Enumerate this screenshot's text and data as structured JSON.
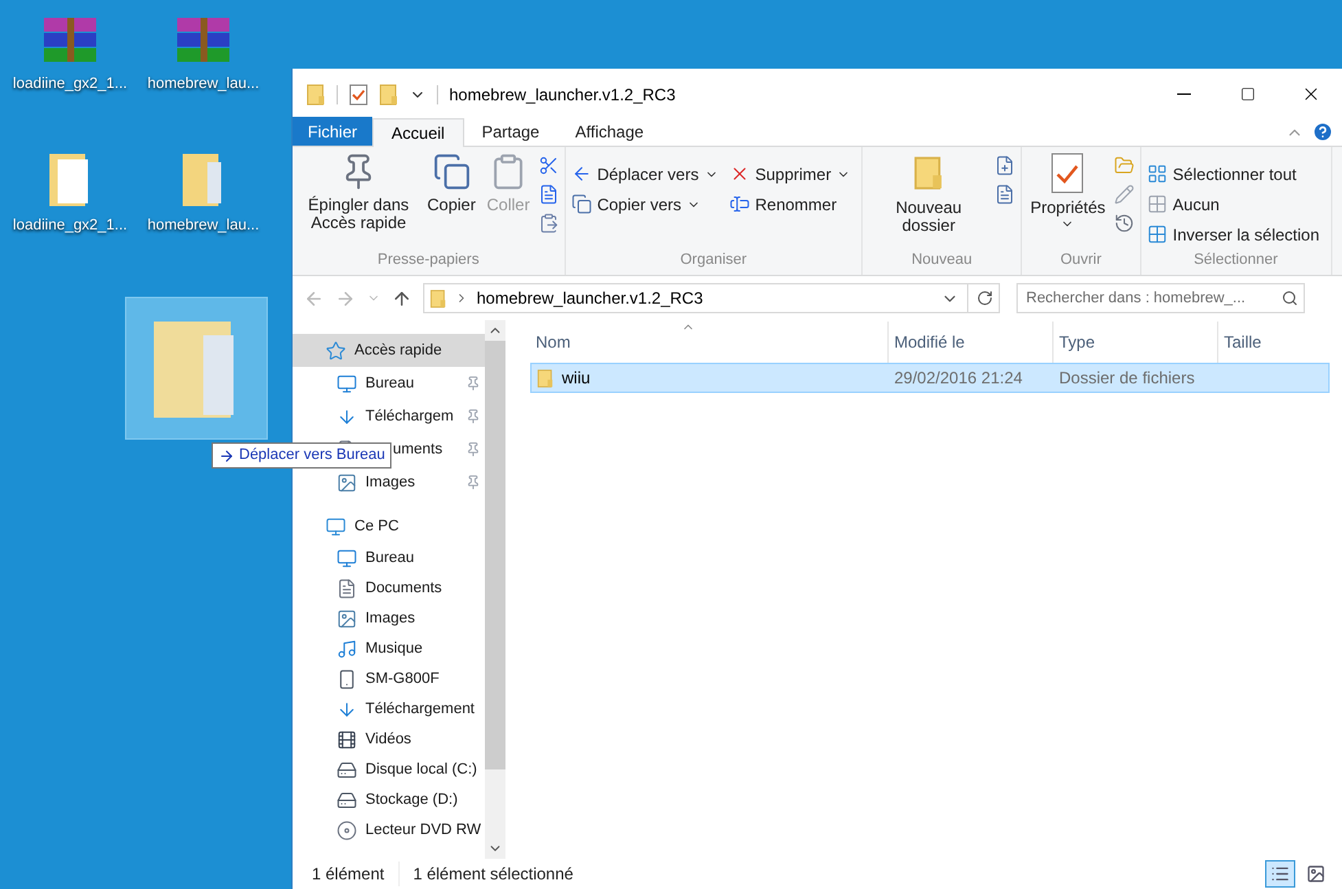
{
  "desktop": {
    "icons": [
      {
        "label": "loadiine_gx2_1...",
        "kind": "archive"
      },
      {
        "label": "homebrew_lau...",
        "kind": "archive"
      },
      {
        "label": "loadiine_gx2_1...",
        "kind": "document"
      },
      {
        "label": "homebrew_lau...",
        "kind": "folder"
      }
    ],
    "drag": {
      "tooltip": "Déplacer vers Bureau"
    }
  },
  "window": {
    "title": "homebrew_launcher.v1.2_RC3",
    "tabs": [
      {
        "label": "Fichier",
        "kind": "file",
        "selected": false
      },
      {
        "label": "Accueil",
        "kind": "tab",
        "selected": true
      },
      {
        "label": "Partage",
        "kind": "tab",
        "selected": false
      },
      {
        "label": "Affichage",
        "kind": "tab",
        "selected": false
      }
    ],
    "ribbon": [
      {
        "label": "Presse-papiers",
        "items": [
          {
            "kind": "large",
            "label": "Épingler dans Accès rapide",
            "disabled": false,
            "dropdown": false
          },
          {
            "kind": "large",
            "label": "Copier",
            "disabled": false,
            "dropdown": false
          },
          {
            "kind": "large",
            "label": "Coller",
            "disabled": true,
            "dropdown": false
          },
          {
            "kind": "icons"
          }
        ]
      },
      {
        "label": "Organiser",
        "items": [
          {
            "kind": "stack",
            "entries": [
              {
                "label": "Déplacer vers",
                "dropdown": true
              },
              {
                "label": "Copier vers",
                "dropdown": true
              }
            ]
          },
          {
            "kind": "stack",
            "entries": [
              {
                "label": "Supprimer",
                "dropdown": true
              },
              {
                "label": "Renommer",
                "dropdown": false
              }
            ]
          }
        ]
      },
      {
        "label": "Nouveau",
        "items": [
          {
            "kind": "large",
            "label": "Nouveau dossier",
            "disabled": false,
            "dropdown": false
          },
          {
            "kind": "icons"
          }
        ]
      },
      {
        "label": "Ouvrir",
        "items": [
          {
            "kind": "large",
            "label": "Propriétés",
            "disabled": false,
            "dropdown": true
          },
          {
            "kind": "icons"
          }
        ]
      },
      {
        "label": "Sélectionner",
        "items": [
          {
            "kind": "stack",
            "entries": [
              {
                "label": "Sélectionner tout",
                "dropdown": false
              },
              {
                "label": "Aucun",
                "dropdown": false
              },
              {
                "label": "Inverser la sélection",
                "dropdown": false
              }
            ]
          }
        ]
      }
    ],
    "address": {
      "path": "homebrew_launcher.v1.2_RC3",
      "search_placeholder": "Rechercher dans : homebrew_..."
    },
    "sidebar": [
      {
        "label": "Accès rapide",
        "kind": "star",
        "selected": true,
        "children": [
          {
            "label": "Bureau",
            "kind": "desktop",
            "pinned": true,
            "partly_hidden": false
          },
          {
            "label": "Téléchargem",
            "kind": "download",
            "pinned": true,
            "partly_hidden": false
          },
          {
            "label": "uments",
            "kind": "document",
            "pinned": true,
            "partly_hidden": true
          },
          {
            "label": "Images",
            "kind": "pictures",
            "pinned": true,
            "partly_hidden": false
          }
        ]
      },
      {
        "label": "Ce PC",
        "kind": "pc",
        "selected": false,
        "children": [
          {
            "label": "Bureau",
            "kind": "desktop",
            "pinned": false,
            "partly_hidden": false
          },
          {
            "label": "Documents",
            "kind": "document",
            "pinned": false,
            "partly_hidden": false
          },
          {
            "label": "Images",
            "kind": "pictures",
            "pinned": false,
            "partly_hidden": false
          },
          {
            "label": "Musique",
            "kind": "music",
            "pinned": false,
            "partly_hidden": false
          },
          {
            "label": "SM-G800F",
            "kind": "phone",
            "pinned": false,
            "partly_hidden": false
          },
          {
            "label": "Téléchargement",
            "kind": "download",
            "pinned": false,
            "partly_hidden": false
          },
          {
            "label": "Vidéos",
            "kind": "video",
            "pinned": false,
            "partly_hidden": false
          },
          {
            "label": "Disque local (C:)",
            "kind": "drive",
            "pinned": false,
            "partly_hidden": false
          },
          {
            "label": "Stockage (D:)",
            "kind": "drive",
            "pinned": false,
            "partly_hidden": false
          },
          {
            "label": "Lecteur DVD RW",
            "kind": "dvd",
            "pinned": false,
            "partly_hidden": false
          }
        ]
      }
    ],
    "columns": [
      "Nom",
      "Modifié le",
      "Type",
      "Taille"
    ],
    "rows": [
      {
        "name": "wiiu",
        "modified": "29/02/2016 21:24",
        "type": "Dossier de fichiers",
        "selected": true
      }
    ],
    "status": [
      "1 élément",
      "1 élément sélectionné"
    ],
    "views": [
      {
        "kind": "details",
        "selected": true
      },
      {
        "kind": "large",
        "selected": false
      }
    ]
  }
}
